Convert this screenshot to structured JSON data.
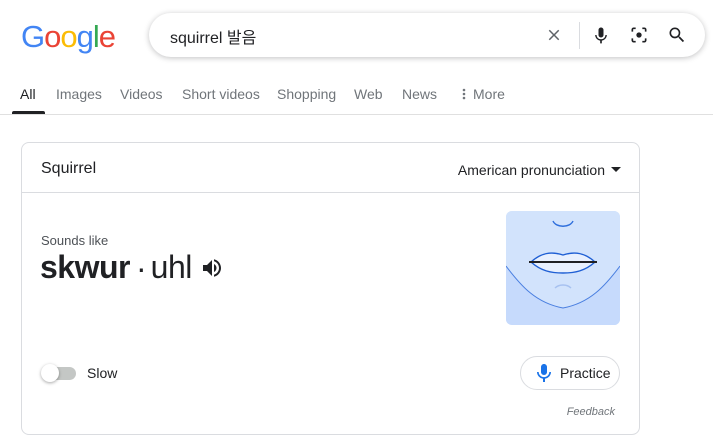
{
  "logo": {
    "letters": [
      {
        "char": "G",
        "color": "#4285F4"
      },
      {
        "char": "o",
        "color": "#EA4335"
      },
      {
        "char": "o",
        "color": "#FBBC05"
      },
      {
        "char": "g",
        "color": "#4285F4"
      },
      {
        "char": "l",
        "color": "#34A853"
      },
      {
        "char": "e",
        "color": "#EA4335"
      }
    ]
  },
  "search": {
    "query": "squirrel 발음",
    "icons": [
      "close-icon",
      "microphone-icon",
      "lens-icon",
      "search-icon"
    ]
  },
  "tabs": [
    {
      "label": "All",
      "active": true
    },
    {
      "label": "Images",
      "active": false
    },
    {
      "label": "Videos",
      "active": false
    },
    {
      "label": "Short videos",
      "active": false
    },
    {
      "label": "Shopping",
      "active": false
    },
    {
      "label": "Web",
      "active": false
    },
    {
      "label": "News",
      "active": false
    },
    {
      "label": "More",
      "active": false,
      "icon": "vertical-dots-icon"
    }
  ],
  "card": {
    "word": "Squirrel",
    "pronunciation_variant": "American pronunciation",
    "sounds_like_label": "Sounds like",
    "syllables": {
      "stressed": "skwur",
      "separator": "·",
      "unstressed": "uhl"
    },
    "slow_label": "Slow",
    "slow_enabled": false,
    "practice_label": "Practice",
    "feedback_label": "Feedback"
  },
  "colors": {
    "accent_blue": "#1a73e8",
    "mouth_panel_bg": "#d2e3fc",
    "text_primary": "#202124",
    "text_secondary": "#70757a"
  }
}
